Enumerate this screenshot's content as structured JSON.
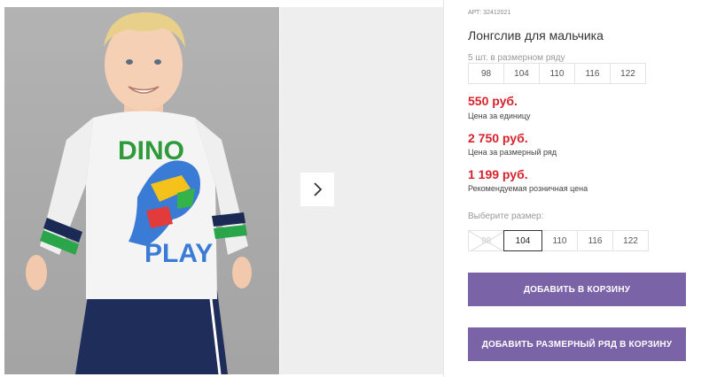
{
  "gallery": {
    "print_letters_top": "DINO",
    "print_letters_bottom": "PLAY"
  },
  "product": {
    "article": "АРТ: 32412021",
    "title": "Лонгслив для мальчика",
    "pack_note": "5 шт. в размерном ряду",
    "pack_sizes": [
      "98",
      "104",
      "110",
      "116",
      "122"
    ]
  },
  "prices": {
    "unit_price": "550 руб.",
    "unit_label": "Цена за единицу",
    "set_price": "2 750 руб.",
    "set_label": "Цена за размерный ряд",
    "retail_price": "1 199 руб.",
    "retail_label": "Рекомендуемая розничная цена",
    "price_color": "#d7222e"
  },
  "size_select": {
    "label": "Выберите размер:",
    "options": [
      "98",
      "104",
      "110",
      "116",
      "122"
    ],
    "selected": "104",
    "unavailable": [
      "98"
    ]
  },
  "actions": {
    "add_to_cart": "ДОБАВИТЬ В КОРЗИНУ",
    "add_set_to_cart": "ДОБАВИТЬ РАЗМЕРНЫЙ РЯД В КОРЗИНУ",
    "button_color": "#7b63a8"
  },
  "icons": {
    "next": "chevron-right-icon",
    "unavailable": "cross-out-icon"
  }
}
